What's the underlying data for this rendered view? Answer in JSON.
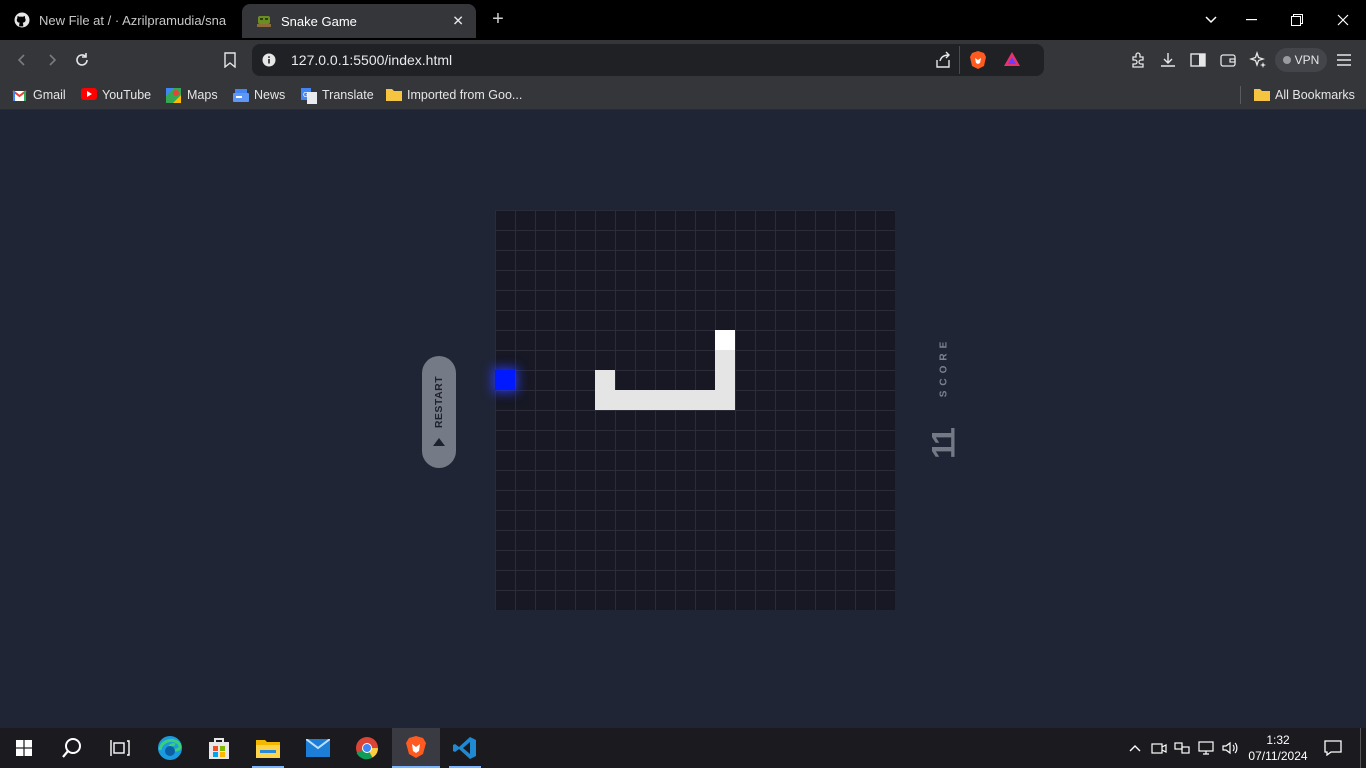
{
  "tabs": [
    {
      "label": "New File at / · Azrilpramudia/snake-",
      "icon": "github-icon",
      "active": false
    },
    {
      "label": "Snake Game",
      "icon": "snake-favicon",
      "active": true
    }
  ],
  "toolbar": {
    "url": "127.0.0.1:5500/index.html",
    "vpn_label": "VPN"
  },
  "bookmarks": [
    {
      "label": "Gmail",
      "icon": "gmail-icon"
    },
    {
      "label": "YouTube",
      "icon": "youtube-icon"
    },
    {
      "label": "Maps",
      "icon": "maps-icon"
    },
    {
      "label": "News",
      "icon": "news-icon"
    },
    {
      "label": "Translate",
      "icon": "translate-icon"
    },
    {
      "label": "Imported from Goo...",
      "icon": "folder-icon"
    }
  ],
  "all_bookmarks": {
    "label": "All Bookmarks",
    "icon": "folder-icon"
  },
  "game": {
    "grid_cols": 20,
    "grid_rows": 20,
    "snake": [
      [
        11,
        6
      ],
      [
        11,
        7
      ],
      [
        11,
        8
      ],
      [
        11,
        9
      ],
      [
        10,
        9
      ],
      [
        9,
        9
      ],
      [
        8,
        9
      ],
      [
        7,
        9
      ],
      [
        6,
        9
      ],
      [
        5,
        9
      ],
      [
        5,
        8
      ]
    ],
    "food": [
      0,
      8
    ],
    "colors": {
      "board": "#171824",
      "snake": "#e5e5e5",
      "head": "#ffffff",
      "food": "#0019ff",
      "page": "#202535"
    },
    "restart_label": "RESTART",
    "score_label": "SCORE",
    "score": "11"
  },
  "taskbar": {
    "time": "1:32",
    "date": "07/11/2024",
    "apps": [
      "windows-start-icon",
      "search-icon",
      "task-view-icon",
      "edge-icon",
      "store-icon",
      "file-explorer-icon",
      "mail-icon",
      "chrome-icon",
      "brave-icon",
      "vscode-icon"
    ]
  }
}
